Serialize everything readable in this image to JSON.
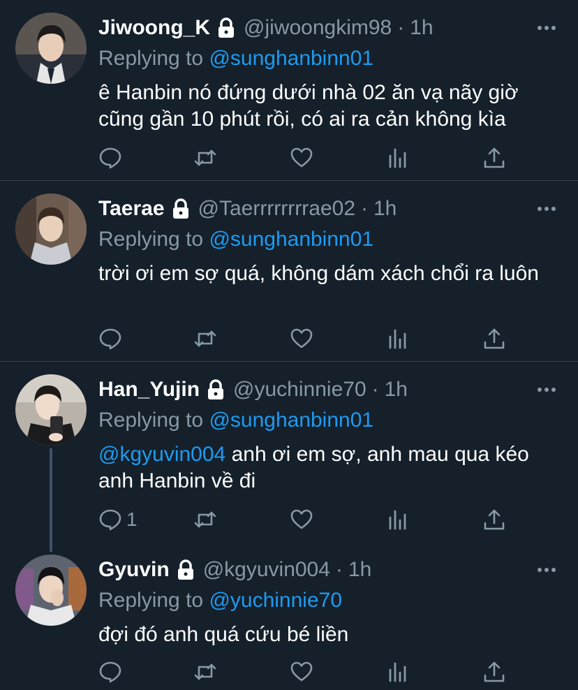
{
  "colors": {
    "background": "#15202b",
    "text_primary": "#ffffff",
    "text_secondary": "#8899a6",
    "link": "#1d9bf0",
    "divider": "#38444d",
    "thread_line": "#3d5466"
  },
  "icons": {
    "protected": "lock-icon",
    "more": "more-horizontal-icon",
    "reply": "reply-bubble-icon",
    "retweet": "retweet-icon",
    "like": "heart-icon",
    "analytics": "bar-chart-icon",
    "share": "share-upload-icon"
  },
  "reply_prefix": "Replying to",
  "dot": "·",
  "tweets": [
    {
      "display_name": "Jiwoong_K",
      "handle": "@jiwoongkim98",
      "time": "1h",
      "replying_to": "@sunghanbinn01",
      "text_mention": "",
      "text": "ê Hanbin nó đứng dưới nhà 02 ăn vạ nãy giờ cũng gần 10 phút rồi, có ai ra cản không kìa",
      "reply_count": ""
    },
    {
      "display_name": "Taerae",
      "handle": "@Taerrrrrrrrae02",
      "time": "1h",
      "replying_to": "@sunghanbinn01",
      "text_mention": "",
      "text": "trời ơi em sợ quá, không dám xách chổi ra luôn",
      "reply_count": ""
    },
    {
      "display_name": "Han_Yujin",
      "handle": "@yuchinnie70",
      "time": "1h",
      "replying_to": "@sunghanbinn01",
      "text_mention": "@kgyuvin004",
      "text": " anh ơi em sợ, anh mau qua kéo anh Hanbin về đi",
      "reply_count": "1"
    },
    {
      "display_name": "Gyuvin",
      "handle": "@kgyuvin004",
      "time": "1h",
      "replying_to": "@yuchinnie70",
      "text_mention": "",
      "text": "đợi đó anh quá cứu bé liền",
      "reply_count": ""
    }
  ]
}
